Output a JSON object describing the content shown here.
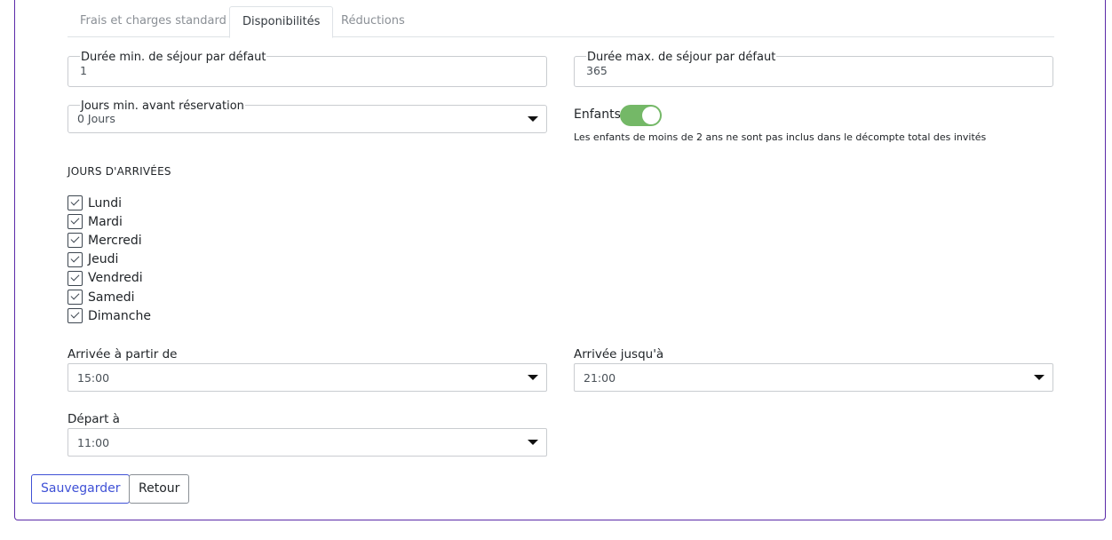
{
  "tabs": [
    {
      "label": "Frais et charges standard",
      "active": false
    },
    {
      "label": "Disponibilités",
      "active": true
    },
    {
      "label": "Réductions",
      "active": false
    }
  ],
  "min_stay": {
    "label": "Durée min. de séjour par défaut",
    "value": "1"
  },
  "max_stay": {
    "label": "Durée max. de séjour par défaut",
    "value": "365"
  },
  "min_days_before": {
    "label": "Jours min. avant réservation",
    "value": "0 Jours"
  },
  "children": {
    "label": "Enfants",
    "enabled": true,
    "hint": "Les enfants de moins de 2 ans ne sont pas inclus dans le décompte total des invités",
    "toggle_color": "#74b867"
  },
  "arrival_days": {
    "title": "JOURS D'ARRIVÉES",
    "days": [
      {
        "label": "Lundi",
        "checked": true
      },
      {
        "label": "Mardi",
        "checked": true
      },
      {
        "label": "Mercredi",
        "checked": true
      },
      {
        "label": "Jeudi",
        "checked": true
      },
      {
        "label": "Vendredi",
        "checked": true
      },
      {
        "label": "Samedi",
        "checked": true
      },
      {
        "label": "Dimanche",
        "checked": true
      }
    ]
  },
  "arrival_from": {
    "label": "Arrivée à partir de",
    "value": "15:00"
  },
  "arrival_until": {
    "label": "Arrivée jusqu'à",
    "value": "21:00"
  },
  "departure": {
    "label": "Départ à",
    "value": "11:00"
  },
  "actions": {
    "save_label": "Sauvegarder",
    "back_label": "Retour",
    "primary_color": "#3f51d6"
  },
  "panel_border_color": "#5b2aa8"
}
